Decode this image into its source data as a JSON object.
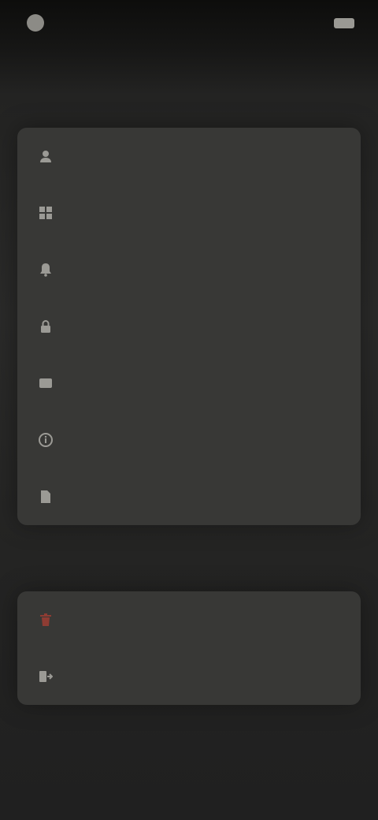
{
  "status_bar": {
    "app_name": "",
    "right_text": "",
    "battery_icon": "battery-icon"
  },
  "general": {
    "header": "",
    "items": [
      {
        "label": "",
        "icon": "user-icon"
      },
      {
        "label": "",
        "icon": "grid-icon"
      },
      {
        "label": "",
        "icon": "bell-icon"
      },
      {
        "label": "",
        "icon": "lock-icon"
      },
      {
        "label": "",
        "icon": "card-icon"
      },
      {
        "label": "",
        "icon": "info-icon"
      },
      {
        "label": "",
        "icon": "document-icon"
      }
    ]
  },
  "danger_zone": {
    "header": "",
    "items": [
      {
        "label": "",
        "icon": "trash-icon",
        "color": "#8e3c33"
      },
      {
        "label": "",
        "icon": "logout-icon"
      }
    ]
  },
  "footer": {
    "text": ""
  },
  "colors": {
    "background": "#242423",
    "card": "#383836",
    "danger": "#8e3c33"
  }
}
